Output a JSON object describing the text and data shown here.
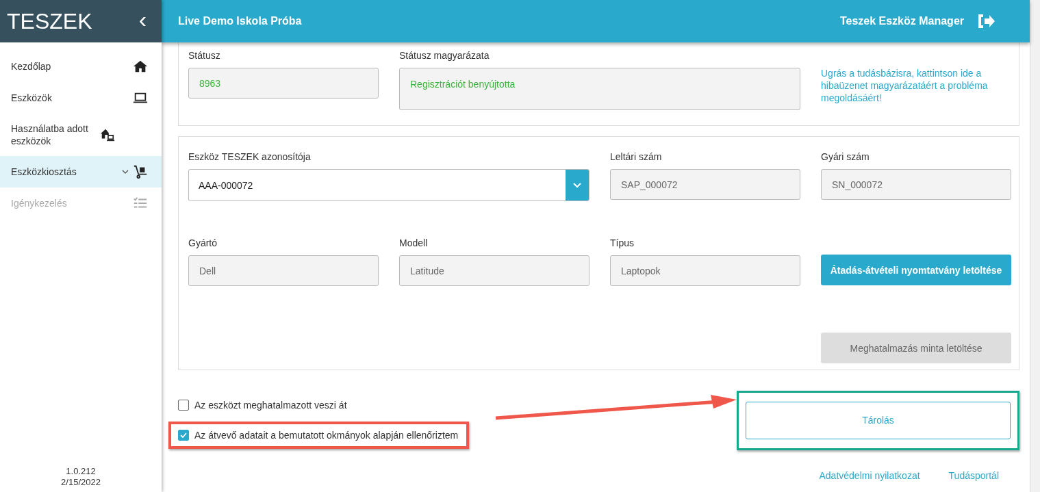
{
  "sidebar": {
    "logo": "TESZEK",
    "collapse_icon": "‹",
    "items": [
      {
        "label": "Kezdőlap",
        "kind": "home",
        "selected": false,
        "disabled": false,
        "expandable": false
      },
      {
        "label": "Eszközök",
        "kind": "laptop",
        "selected": false,
        "disabled": false,
        "expandable": false
      },
      {
        "label": "Használatba adott eszközök",
        "kind": "home-laptop",
        "selected": false,
        "disabled": false,
        "expandable": false
      },
      {
        "label": "Eszközkiosztás",
        "kind": "dolly",
        "selected": true,
        "disabled": false,
        "expandable": true
      },
      {
        "label": "Igénykezelés",
        "kind": "checklist",
        "selected": false,
        "disabled": true,
        "expandable": false
      }
    ],
    "version": "1.0.212",
    "date": "2/15/2022"
  },
  "header": {
    "title": "Live Demo Iskola Próba",
    "app_name": "Teszek Eszköz Manager"
  },
  "status_card": {
    "status_label": "Státusz",
    "status_value": "8963",
    "explanation_label": "Státusz magyarázata",
    "explanation_value": "Regisztrációt benyújtotta",
    "help_link": "Ugrás a tudásbázisra, kattintson ide a hibaüzenet magyarázatáért a probléma megoldásáért!"
  },
  "device_card": {
    "device_id_label": "Eszköz TESZEK azonosítója",
    "device_id_value": "AAA-000072",
    "fields_row1": [
      {
        "label": "Leltári szám",
        "value": "SAP_000072"
      },
      {
        "label": "Gyári szám",
        "value": "SN_000072"
      }
    ],
    "fields_row2": [
      {
        "label": "Gyártó",
        "value": "Dell"
      },
      {
        "label": "Modell",
        "value": "Latitude"
      },
      {
        "label": "Típus",
        "value": "Laptopok"
      }
    ],
    "download_button": {
      "label": "Átadás-átvételi nyomtatvány letöltése",
      "disabled": false
    },
    "authorization_button": {
      "label": "Meghatalmazás minta letöltése",
      "disabled": true
    }
  },
  "checkboxes": [
    {
      "label": "Az eszközt meghatalmazott veszi át",
      "checked": false,
      "highlighted": false
    },
    {
      "label": "Az átvevő adatait a bemutatott okmányok alapján ellenőriztem",
      "checked": true,
      "highlighted": true
    }
  ],
  "save_button": {
    "label": "Tárolás",
    "highlighted": true
  },
  "footer_links": [
    "Adatvédelmi nyilatkozat",
    "Tudásportál"
  ]
}
